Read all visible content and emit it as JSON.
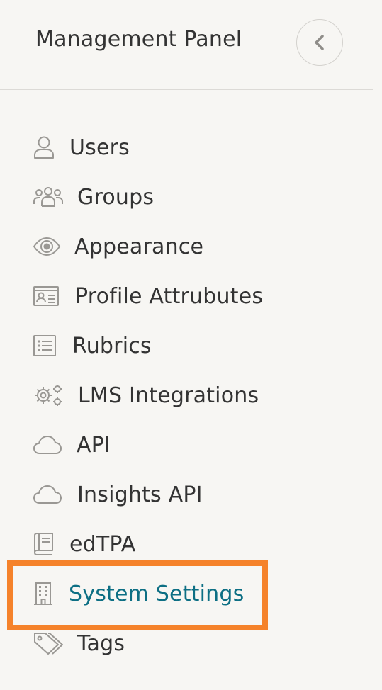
{
  "header": {
    "title": "Management Panel",
    "collapse_icon": "chevron-left-icon"
  },
  "nav": {
    "items": [
      {
        "label": "Users",
        "icon": "user-icon"
      },
      {
        "label": "Groups",
        "icon": "groups-icon"
      },
      {
        "label": "Appearance",
        "icon": "eye-icon"
      },
      {
        "label": "Profile Attrubutes",
        "icon": "id-card-icon"
      },
      {
        "label": "Rubrics",
        "icon": "list-icon"
      },
      {
        "label": "LMS Integrations",
        "icon": "gears-icon"
      },
      {
        "label": "API",
        "icon": "cloud-icon"
      },
      {
        "label": "Insights API",
        "icon": "cloud-icon"
      },
      {
        "label": "edTPA",
        "icon": "book-icon"
      },
      {
        "label": "System Settings",
        "icon": "building-icon",
        "active": true
      },
      {
        "label": "Tags",
        "icon": "tags-icon"
      }
    ]
  },
  "colors": {
    "background": "#f7f6f3",
    "text": "#333333",
    "active_text": "#0d6f84",
    "icon": "#9a9894",
    "highlight_border": "#f5822a"
  }
}
